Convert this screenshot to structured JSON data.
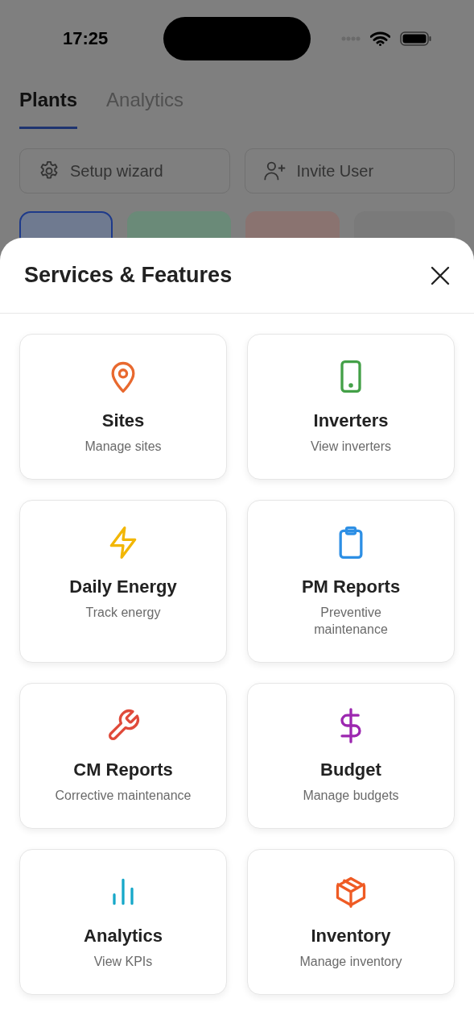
{
  "status_bar": {
    "time": "17:25"
  },
  "tabs": [
    {
      "label": "Plants",
      "selected": true
    },
    {
      "label": "Analytics",
      "selected": false
    }
  ],
  "actions": [
    {
      "label": "Setup wizard",
      "kind": "gear"
    },
    {
      "label": "Invite User",
      "kind": "user-plus"
    }
  ],
  "tiles": [
    {
      "color": "#6f7a90",
      "selected": true
    },
    {
      "color": "#6a8a78",
      "selected": false
    },
    {
      "color": "#8a7370",
      "selected": false
    },
    {
      "color": "#7a7a7a",
      "selected": false
    }
  ],
  "sheet": {
    "title": "Services & Features",
    "items": [
      {
        "title": "Sites",
        "subtitle": "Manage sites",
        "kind": "pin",
        "color": "#e8692f"
      },
      {
        "title": "Inverters",
        "subtitle": "View inverters",
        "kind": "phone",
        "color": "#43a047"
      },
      {
        "title": "Daily Energy",
        "subtitle": "Track energy",
        "kind": "bolt",
        "color": "#f2b705"
      },
      {
        "title": "PM Reports",
        "subtitle": "Preventive maintenance",
        "kind": "clipboard",
        "color": "#2d8fe5"
      },
      {
        "title": "CM Reports",
        "subtitle": "Corrective maintenance",
        "kind": "wrench",
        "color": "#e04a3a"
      },
      {
        "title": "Budget",
        "subtitle": "Manage budgets",
        "kind": "dollar",
        "color": "#9c27b0"
      },
      {
        "title": "Analytics",
        "subtitle": "View KPIs",
        "kind": "bars",
        "color": "#17a8c9"
      },
      {
        "title": "Inventory",
        "subtitle": "Manage inventory",
        "kind": "box",
        "color": "#ef5b24"
      }
    ]
  }
}
